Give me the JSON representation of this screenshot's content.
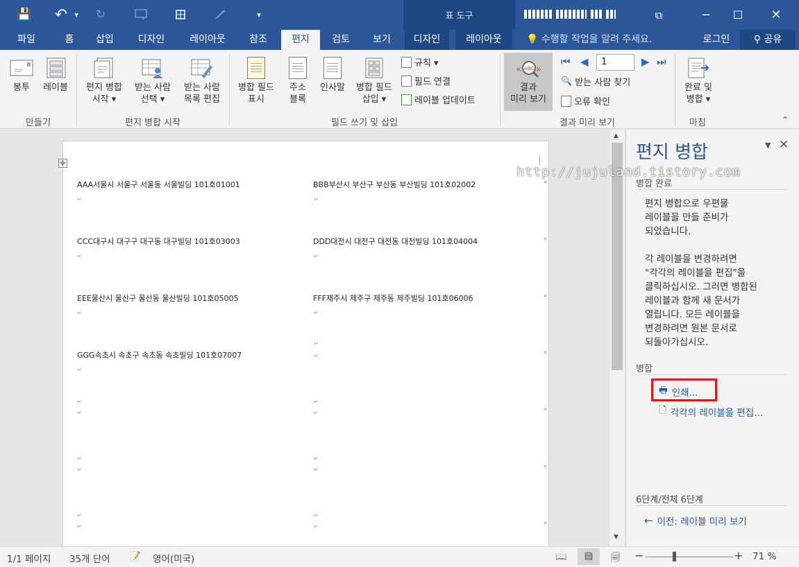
{
  "window": {
    "contextual_tab_group": "표 도구",
    "minimize": "─",
    "maximize": "☐",
    "close": "✕",
    "ribbon_display": "⧉"
  },
  "qat": {
    "save": "💾",
    "undo": "↶",
    "undo_dropdown": "▾",
    "redo": "↻",
    "customize": "▾"
  },
  "tabs": [
    "파일",
    "홈",
    "삽입",
    "디자인",
    "레이아웃",
    "참조",
    "편지",
    "검토",
    "보기",
    "디자인",
    "레이아웃"
  ],
  "active_tab": "편지",
  "tell_me": "수행할 작업을 알려 주세요.",
  "signin": "로그인",
  "share": "공유",
  "ribbon": {
    "envelope": "봉투",
    "labels": "레이블",
    "start_merge_l1": "편지 병합",
    "start_merge_l2": "시작 ▾",
    "select_recipients_l1": "받는 사람",
    "select_recipients_l2": "선택 ▾",
    "edit_list_l1": "받는 사람",
    "edit_list_l2": "목록 편집",
    "highlight_fields_l1": "병합 필드",
    "highlight_fields_l2": "표시",
    "address_block_l1": "주소",
    "address_block_l2": "블록",
    "greeting_line": "인사말",
    "insert_field_l1": "병합 필드",
    "insert_field_l2": "삽입 ▾",
    "rules": "규칙 ▾",
    "match_fields": "필드 연결",
    "update_labels": "레이블 업데이트",
    "preview_l1": "결과",
    "preview_l2": "미리 보기",
    "record_value": "1",
    "find_recipient": "받는 사람 찾기",
    "check_errors": "오류 확인",
    "finish_l1": "완료 및",
    "finish_l2": "병합 ▾",
    "group_create": "만들기",
    "group_start": "편지 병합 시작",
    "group_write": "필드 쓰기 및 삽입",
    "group_preview": "결과 미리 보기",
    "group_finish": "마침"
  },
  "document": {
    "labels": [
      "AAA서울시 서울구 서울동 서울빌딩 101호01001",
      "BBB부산시 부산구 부산동 부산빌딩 101호02002",
      "CCC대구시 대구구 대구동 대구빌딩 101호03003",
      "DDD대전시 대전구 대전동 대전빌딩 101호04004",
      "EEE울산시 울산구 울산동 울산빌딩 101호05005",
      "FFF제주시 제주구 제주동 제주빌딩 101호06006",
      "GGG속초시 속초구 속초동 속초빌딩 101호07007"
    ],
    "watermark": "http://jujuland.tistory.com"
  },
  "pane": {
    "title": "편지 병합",
    "section_complete": "병합 완료",
    "body": "편지 병합으로 우편물\n레이블을 만들 준비가\n되었습니다.\n\n각 레이블을 변경하려면\n\"각각의 레이블을 편집\"을\n클릭하십시오. 그러면 병합된\n레이블과 함께 새 문서가\n열립니다. 모든 레이블을\n변경하려면 원본 문서로\n되돌아가십시오.",
    "section_merge": "병합",
    "print_link": "인쇄...",
    "edit_link": "각각의 레이블을 편집...",
    "step": "6단계/전체 6단계",
    "prev_link": "이전: 레이블 미리 보기"
  },
  "status": {
    "page": "1/1 페이지",
    "words": "35개 단어",
    "language": "영어(미국)",
    "zoom_minus": "−",
    "zoom_plus": "+",
    "zoom": "71 %"
  }
}
